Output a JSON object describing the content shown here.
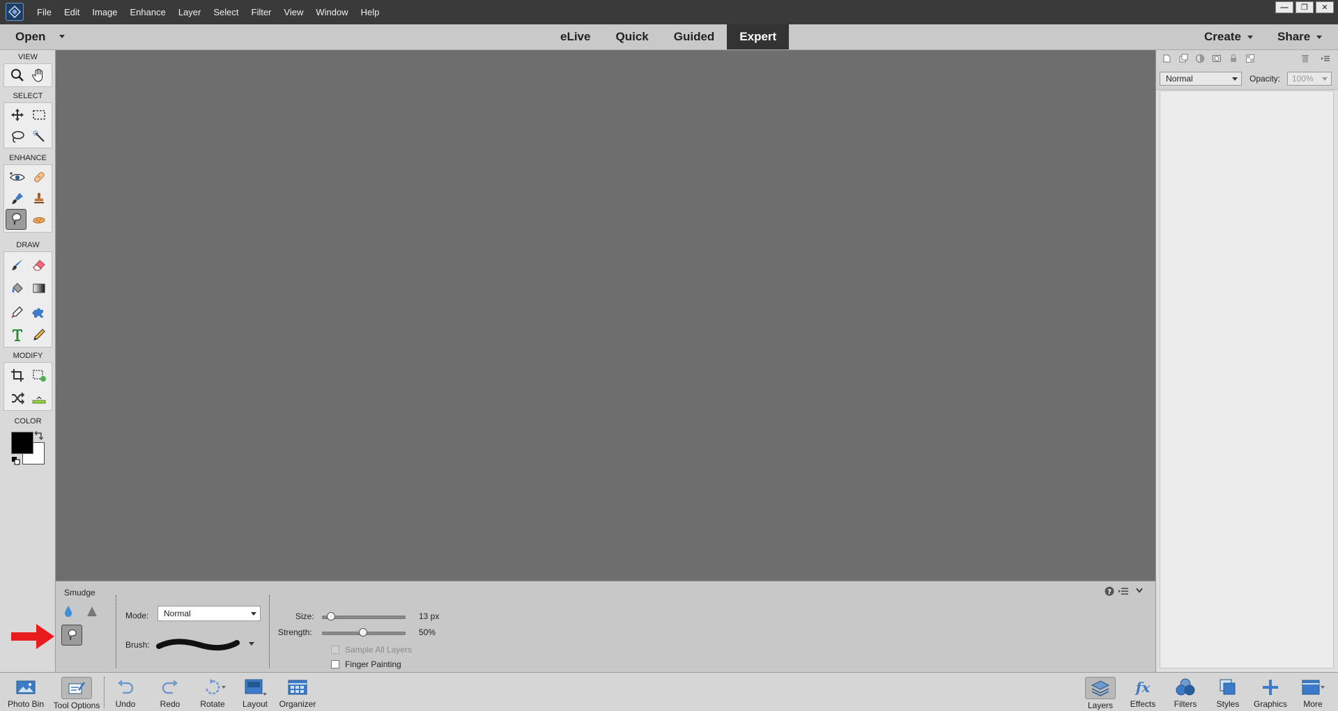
{
  "menu": {
    "items": [
      "File",
      "Edit",
      "Image",
      "Enhance",
      "Layer",
      "Select",
      "Filter",
      "View",
      "Window",
      "Help"
    ]
  },
  "window_controls": {
    "minimize": "—",
    "restore": "❐",
    "close": "✕"
  },
  "modebar": {
    "open_label": "Open",
    "tabs": [
      "eLive",
      "Quick",
      "Guided",
      "Expert"
    ],
    "active_tab": "Expert",
    "create_label": "Create",
    "share_label": "Share"
  },
  "toolbox": {
    "sections": {
      "view": "VIEW",
      "select": "SELECT",
      "enhance": "ENHANCE",
      "draw": "DRAW",
      "modify": "MODIFY",
      "color": "COLOR"
    },
    "active_tool": "smudge-tool",
    "foreground_color": "#000000",
    "background_color": "#ffffff"
  },
  "tool_options": {
    "title": "Smudge",
    "mode_label": "Mode:",
    "mode_value": "Normal",
    "brush_label": "Brush:",
    "size_label": "Size:",
    "size_value": "13 px",
    "size_percent": 7,
    "strength_label": "Strength:",
    "strength_value": "50%",
    "strength_percent": 50,
    "sample_all_layers": "Sample All Layers",
    "finger_painting": "Finger Painting"
  },
  "layers_panel": {
    "blend_mode": "Normal",
    "opacity_label": "Opacity:",
    "opacity_value": "100%"
  },
  "taskbar": {
    "left": [
      "Photo Bin",
      "Tool Options",
      "Undo",
      "Redo",
      "Rotate",
      "Layout",
      "Organizer"
    ],
    "right": [
      "Layers",
      "Effects",
      "Filters",
      "Styles",
      "Graphics",
      "More"
    ],
    "active_left": "Tool Options"
  },
  "colors": {
    "accent_blue": "#3d7ac7",
    "annotation_red": "#e81c1c"
  }
}
